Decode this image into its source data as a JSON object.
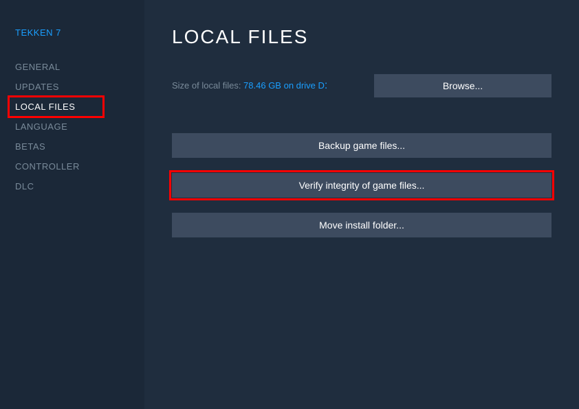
{
  "game_title": "TEKKEN 7",
  "sidebar": {
    "items": [
      {
        "label": "GENERAL"
      },
      {
        "label": "UPDATES"
      },
      {
        "label": "LOCAL FILES"
      },
      {
        "label": "LANGUAGE"
      },
      {
        "label": "BETAS"
      },
      {
        "label": "CONTROLLER"
      },
      {
        "label": "DLC"
      }
    ]
  },
  "main": {
    "title": "LOCAL FILES",
    "size_label": "Size of local files: ",
    "size_value": "78.46 GB on drive D",
    "size_colon": ":",
    "browse_label": "Browse...",
    "buttons": [
      {
        "label": "Backup game files..."
      },
      {
        "label": "Verify integrity of game files..."
      },
      {
        "label": "Move install folder..."
      }
    ]
  }
}
